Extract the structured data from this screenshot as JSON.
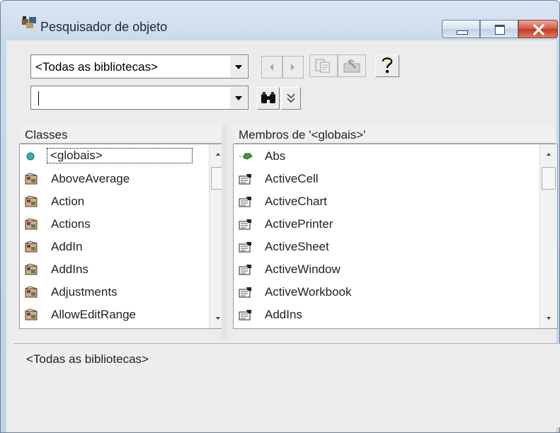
{
  "window": {
    "title": "Pesquisador de objeto",
    "title_icon": "object-browser-icon",
    "caption_buttons": [
      "minimize-icon",
      "maximize-icon",
      "close-icon"
    ]
  },
  "toolbar": {
    "library_combo": {
      "value": "<Todas as bibliotecas>"
    },
    "search_combo": {
      "value": ""
    },
    "buttons": {
      "back": "back-arrow-icon",
      "forward": "forward-arrow-icon",
      "copy": "copy-to-clipboard-icon",
      "view_definition": "view-definition-icon",
      "help": "help-icon",
      "search": "binoculars-icon",
      "toggle_results": "chevron-down-double-icon"
    }
  },
  "classes_pane": {
    "header": "Classes",
    "items": [
      {
        "label": "<globais>",
        "icon": "globals-icon",
        "selected": true
      },
      {
        "label": "AboveAverage",
        "icon": "class-module-icon"
      },
      {
        "label": "Action",
        "icon": "class-module-icon"
      },
      {
        "label": "Actions",
        "icon": "class-module-icon"
      },
      {
        "label": "AddIn",
        "icon": "class-module-icon"
      },
      {
        "label": "AddIns",
        "icon": "class-module-icon"
      },
      {
        "label": "Adjustments",
        "icon": "class-module-icon"
      },
      {
        "label": "AllowEditRange",
        "icon": "class-module-icon"
      }
    ]
  },
  "members_pane": {
    "header": "Membros de '<globais>'",
    "items": [
      {
        "label": "Abs",
        "icon": "method-icon"
      },
      {
        "label": "ActiveCell",
        "icon": "property-icon"
      },
      {
        "label": "ActiveChart",
        "icon": "property-icon"
      },
      {
        "label": "ActivePrinter",
        "icon": "property-icon"
      },
      {
        "label": "ActiveSheet",
        "icon": "property-icon"
      },
      {
        "label": "ActiveWindow",
        "icon": "property-icon"
      },
      {
        "label": "ActiveWorkbook",
        "icon": "property-icon"
      },
      {
        "label": "AddIns",
        "icon": "property-icon"
      }
    ]
  },
  "details_pane": {
    "text": "<Todas as bibliotecas>"
  }
}
